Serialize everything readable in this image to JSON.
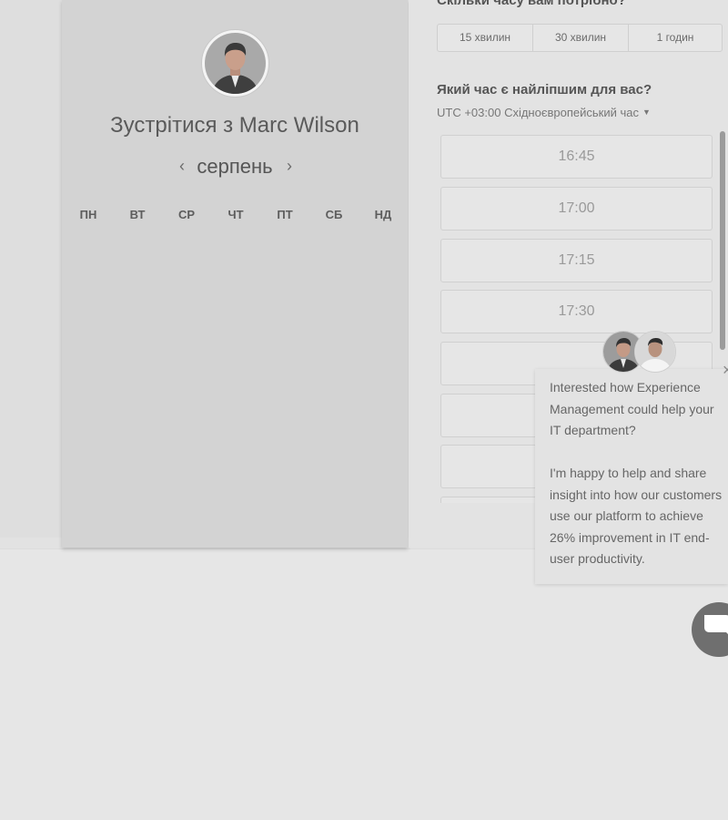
{
  "booking": {
    "title": "Зустрітися з Marc Wilson",
    "month": "серпень",
    "prev_icon": "chevron-left-icon",
    "next_icon": "chevron-right-icon",
    "weekdays": [
      "ПН",
      "ВТ",
      "СР",
      "ЧТ",
      "ПТ",
      "СБ",
      "НД"
    ]
  },
  "duration": {
    "question": "Скільки часу вам потрібно?",
    "options": [
      "15 хвилин",
      "30 хвилин",
      "1 годин"
    ]
  },
  "time": {
    "question": "Який час є найліпшим для вас?",
    "timezone": "UTC +03:00 Східноєвропейський час",
    "slots": [
      "16:45",
      "17:00",
      "17:15",
      "17:30",
      "",
      "",
      "",
      ""
    ]
  },
  "chat": {
    "message_1": "Interested how Experience Management could help your IT department?",
    "message_2": "I'm happy to help and share insight into how our customers use our platform to achieve 26% improvement in IT end-user productivity.",
    "close_icon": "close-icon",
    "launcher_icon": "chat-bubble-icon"
  },
  "colors": {
    "page_bg": "#e6e6e6",
    "card_bg": "#d3d3d3",
    "panel_bg": "#e3e3e3",
    "slot_border": "#d0d0d0"
  }
}
